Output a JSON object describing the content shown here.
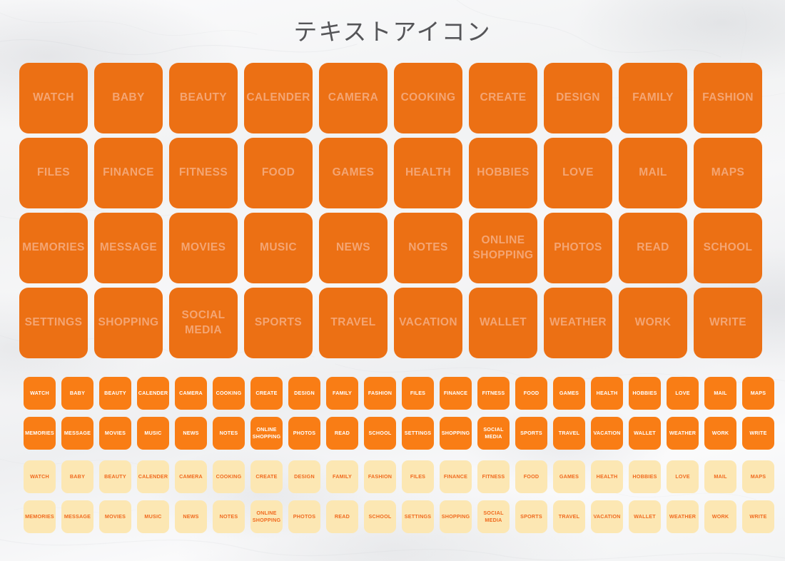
{
  "title": "テキストアイコン",
  "colors": {
    "tile_orange_large": "#EC7014",
    "tile_orange_small": "#F97D15",
    "tile_cream": "#FCE7B3",
    "text_on_large": "#F4A573",
    "text_on_small_orange": "#FFFFFF",
    "text_on_cream": "#F06A1E",
    "background": "#F4F4F5"
  },
  "large_grid": {
    "columns": 10,
    "rows": 4,
    "labels": [
      "WATCH",
      "BABY",
      "BEAUTY",
      "CALENDER",
      "CAMERA",
      "COOKING",
      "CREATE",
      "DESIGN",
      "FAMILY",
      "FASHION",
      "FILES",
      "FINANCE",
      "FITNESS",
      "FOOD",
      "GAMES",
      "HEALTH",
      "HOBBIES",
      "LOVE",
      "MAIL",
      "MAPS",
      "MEMORIES",
      "MESSAGE",
      "MOVIES",
      "MUSIC",
      "NEWS",
      "NOTES",
      "ONLINE\nSHOPPING",
      "PHOTOS",
      "READ",
      "SCHOOL",
      "SETTINGS",
      "SHOPPING",
      "SOCIAL\nMEDIA",
      "SPORTS",
      "TRAVEL",
      "VACATION",
      "WALLET",
      "WEATHER",
      "WORK",
      "WRITE"
    ]
  },
  "small_grid_orange": {
    "columns": 20,
    "rows": 2,
    "labels": [
      "WATCH",
      "BABY",
      "BEAUTY",
      "CALENDER",
      "CAMERA",
      "COOKING",
      "CREATE",
      "DESIGN",
      "FAMILY",
      "FASHION",
      "FILES",
      "FINANCE",
      "FITNESS",
      "FOOD",
      "GAMES",
      "HEALTH",
      "HOBBIES",
      "LOVE",
      "MAIL",
      "MAPS",
      "MEMORIES",
      "MESSAGE",
      "MOVIES",
      "MUSIC",
      "NEWS",
      "NOTES",
      "ONLINE\nSHOPPING",
      "PHOTOS",
      "READ",
      "SCHOOL",
      "SETTINGS",
      "SHOPPING",
      "SOCIAL\nMEDIA",
      "SPORTS",
      "TRAVEL",
      "VACATION",
      "WALLET",
      "WEATHER",
      "WORK",
      "WRITE"
    ]
  },
  "small_grid_cream": {
    "columns": 20,
    "rows": 2,
    "labels": [
      "WATCH",
      "BABY",
      "BEAUTY",
      "CALENDER",
      "CAMERA",
      "COOKING",
      "CREATE",
      "DESIGN",
      "FAMILY",
      "FASHION",
      "FILES",
      "FINANCE",
      "FITNESS",
      "FOOD",
      "GAMES",
      "HEALTH",
      "HOBBIES",
      "LOVE",
      "MAIL",
      "MAPS",
      "MEMORIES",
      "MESSAGE",
      "MOVIES",
      "MUSIC",
      "NEWS",
      "NOTES",
      "ONLINE\nSHOPPING",
      "PHOTOS",
      "READ",
      "SCHOOL",
      "SETTINGS",
      "SHOPPING",
      "SOCIAL\nMEDIA",
      "SPORTS",
      "TRAVEL",
      "VACATION",
      "WALLET",
      "WEATHER",
      "WORK",
      "WRITE"
    ]
  }
}
